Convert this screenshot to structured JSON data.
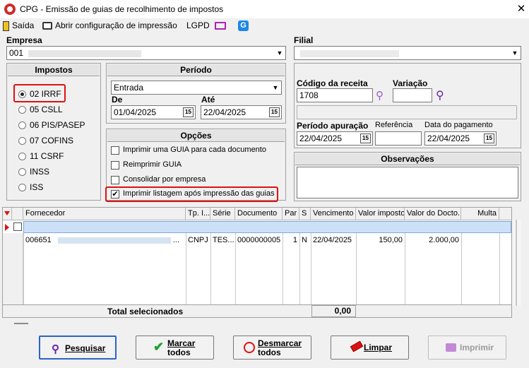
{
  "window": {
    "title": "CPG - Emissão de guias de recolhimento de impostos"
  },
  "menu": {
    "exit": "Saída",
    "print_config": "Abrir configuração de impressão",
    "lgpd": "LGPD"
  },
  "empresa": {
    "label": "Empresa",
    "value": "001"
  },
  "filial": {
    "label": "Filial",
    "value": ""
  },
  "impostos": {
    "title": "Impostos",
    "options": [
      "02 IRRF",
      "05 CSLL",
      "06 PIS/PASEP",
      "07 COFINS",
      "11 CSRF",
      "INSS",
      "ISS"
    ],
    "selected": "02 IRRF"
  },
  "periodo": {
    "title": "Período",
    "type": "Entrada",
    "de_label": "De",
    "de_value": "01/04/2025",
    "ate_label": "Até",
    "ate_value": "22/04/2025"
  },
  "opcoes": {
    "title": "Opções",
    "items": [
      {
        "label": "Imprimir uma GUIA para cada documento",
        "checked": false
      },
      {
        "label": "Reimprimir GUIA",
        "checked": false
      },
      {
        "label": "Consolidar por empresa",
        "checked": false
      },
      {
        "label": "Imprimir listagem após impressão das guias",
        "checked": true
      }
    ]
  },
  "receita": {
    "codigo_label": "Código da receita",
    "codigo_value": "1708",
    "variacao_label": "Variação",
    "variacao_value": "",
    "periodo_apuracao_label": "Período apuração",
    "periodo_apuracao_value": "22/04/2025",
    "referencia_label": "Referência",
    "referencia_value": "",
    "data_pagamento_label": "Data do pagamento",
    "data_pagamento_value": "22/04/2025"
  },
  "observacoes": {
    "title": "Observações",
    "value": ""
  },
  "calendar_glyph": "15",
  "grid": {
    "columns": [
      "Fornecedor",
      "Tp. I...",
      "Série",
      "Documento",
      "Par",
      "S",
      "Vencimento",
      "Valor imposto",
      "Valor do Docto.",
      "Multa"
    ],
    "rows": [
      {
        "fornecedor": "006651",
        "ellipsis": "...",
        "tp": "CNPJ",
        "serie": "TES...",
        "documento": "0000000005",
        "par": "1",
        "s": "N",
        "vencimento": "22/04/2025",
        "valor_imposto": "150,00",
        "valor_docto": "2.000,00",
        "multa": ""
      }
    ],
    "total_label": "Total selecionados",
    "total_value": "0,00"
  },
  "buttons": {
    "pesquisar": "Pesquisar",
    "marcar_1": "Marcar",
    "marcar_2": "todos",
    "desmarcar_1": "Desmarcar",
    "desmarcar_2": "todos",
    "limpar": "Limpar",
    "imprimir": "Imprimir"
  },
  "colors": {
    "accent_blue": "#2b63c7",
    "highlight_red": "#e01010",
    "selected_row": "#cce0f7"
  }
}
